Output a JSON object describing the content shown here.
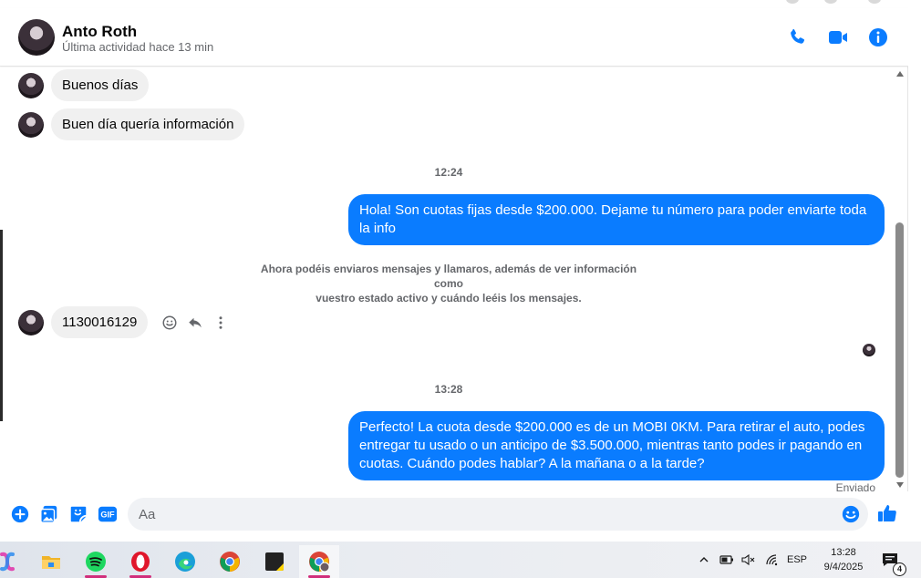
{
  "colors": {
    "accent": "#0a7cff",
    "bubble_in": "#f0f0f0",
    "muted_text": "#65676b"
  },
  "header": {
    "contact_name": "Anto Roth",
    "status": "Última actividad hace 13 min",
    "icons": [
      "phone-icon",
      "video-camera-icon",
      "info-icon"
    ]
  },
  "messages": {
    "incoming_1": "Buenos días",
    "incoming_2": "Buen día quería información",
    "time_1": "12:24",
    "outgoing_1": "Hola! Son cuotas fijas desde $200.000. Dejame tu número para poder enviarte toda la info",
    "notice_line_1": "Ahora podéis enviaros mensajes y llamaros, además de ver información como",
    "notice_line_2": "vuestro estado activo y cuándo leéis los mensajes.",
    "incoming_3": "1130016129",
    "time_2": "13:28",
    "outgoing_2": "Perfecto! La cuota desde $200.000 es de un MOBI 0KM. Para retirar el auto, podes entregar tu usado o un anticipo de $3.500.000, mientras tanto podes ir pagando en cuotas. Cuándo podes hablar? A la mañana o a la tarde?",
    "sent_status": "Enviado"
  },
  "composer": {
    "placeholder": "Aa",
    "gif_label": "GIF",
    "icons": [
      "plus-icon",
      "photo-icon",
      "sticker-icon",
      "gif-icon",
      "emoji-icon",
      "thumbs-up-icon"
    ]
  },
  "taskbar": {
    "apps": [
      "copilot-icon",
      "file-explorer-icon",
      "spotify-icon",
      "opera-icon",
      "edge-icon",
      "chrome-icon",
      "sticky-notes-icon",
      "chrome-profile-icon"
    ],
    "language": "ESP",
    "time": "13:28",
    "date": "9/4/2025",
    "notification_count": "4"
  }
}
